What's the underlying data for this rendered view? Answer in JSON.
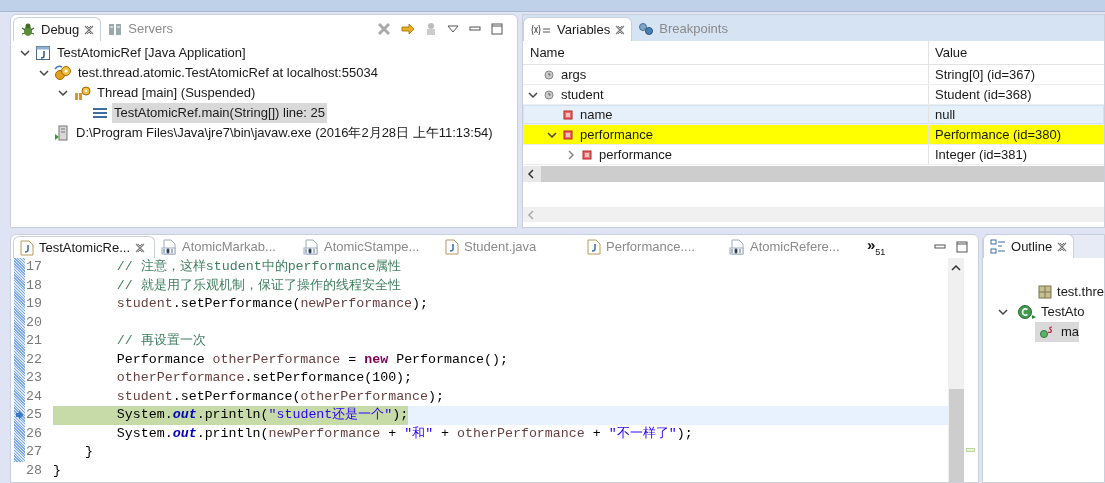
{
  "debug_view": {
    "tabs": [
      {
        "label": "Debug",
        "selected": true,
        "kind": "bug"
      },
      {
        "label": "Servers",
        "selected": false,
        "kind": "servers"
      }
    ],
    "tree": [
      {
        "label": "TestAtomicRef [Java Application]",
        "kind": "launch",
        "expanded": true,
        "selected": false,
        "children": [
          {
            "label": "test.thread.atomic.TestAtomicRef at localhost:55034",
            "kind": "vm",
            "expanded": true,
            "selected": false,
            "children": [
              {
                "label": "Thread [main] (Suspended)",
                "kind": "thread",
                "expanded": true,
                "selected": false,
                "children": [
                  {
                    "label": "TestAtomicRef.main(String[]) line: 25",
                    "kind": "frame",
                    "selected": true
                  }
                ]
              }
            ]
          },
          {
            "label": "D:\\Program Files\\Java\\jre7\\bin\\javaw.exe (2016年2月28日 上午11:13:54)",
            "kind": "process",
            "selected": false
          }
        ]
      }
    ]
  },
  "variables_view": {
    "tabs": [
      {
        "label": "Variables",
        "selected": true,
        "kind": "variables"
      },
      {
        "label": "Breakpoints",
        "selected": false,
        "kind": "breakpoints"
      }
    ],
    "columns": [
      "Name",
      "Value"
    ],
    "rows": [
      {
        "name": "args",
        "value": "String[0]  (id=367)",
        "kind": "local",
        "selected": false,
        "changed": false
      },
      {
        "name": "student",
        "value": "Student  (id=368)",
        "kind": "local",
        "expanded": true,
        "selected": false,
        "changed": false,
        "children": [
          {
            "name": "name",
            "value": "null",
            "kind": "field",
            "selected": true,
            "changed": false
          },
          {
            "name": "performance",
            "value": "Performance  (id=380)",
            "kind": "field",
            "expanded": true,
            "selected": false,
            "changed": true,
            "children": [
              {
                "name": "performance",
                "value": "Integer  (id=381)",
                "kind": "field",
                "expanded": false,
                "selected": false,
                "changed": false
              }
            ]
          }
        ]
      }
    ]
  },
  "editor": {
    "tabs": [
      {
        "label": "TestAtomicRe...",
        "selected": true,
        "kind": "java"
      },
      {
        "label": "AtomicMarkab...",
        "selected": false,
        "kind": "class"
      },
      {
        "label": "AtomicStampe...",
        "selected": false,
        "kind": "class"
      },
      {
        "label": "Student.java",
        "selected": false,
        "kind": "java"
      },
      {
        "label": "Performance....",
        "selected": false,
        "kind": "java"
      },
      {
        "label": "AtomicRefere...",
        "selected": false,
        "kind": "class"
      }
    ],
    "overflow": {
      "symbol": "»",
      "count": "51"
    },
    "lines": [
      {
        "number": "17",
        "current": false,
        "tokens": [
          {
            "kind": "comment",
            "text": "        // 注意，这样student中的performance属性"
          }
        ]
      },
      {
        "number": "18",
        "current": false,
        "tokens": [
          {
            "kind": "comment",
            "text": "        // 就是用了乐观机制，保证了操作的线程安全性"
          }
        ]
      },
      {
        "number": "19",
        "current": false,
        "tokens": [
          {
            "kind": "var",
            "text": "        student"
          },
          {
            "kind": "plain",
            "text": ".setPerformance("
          },
          {
            "kind": "var",
            "text": "newPerformance"
          },
          {
            "kind": "plain",
            "text": ");"
          }
        ]
      },
      {
        "number": "20",
        "current": false
      },
      {
        "number": "21",
        "current": false,
        "tokens": [
          {
            "kind": "comment",
            "text": "        // 再设置一次"
          }
        ]
      },
      {
        "number": "22",
        "current": false,
        "tokens": [
          {
            "kind": "plain",
            "text": "        Performance "
          },
          {
            "kind": "var",
            "text": "otherPerformance"
          },
          {
            "kind": "plain",
            "text": " = "
          },
          {
            "kind": "keyword",
            "text": "new"
          },
          {
            "kind": "plain",
            "text": " Performance();"
          }
        ]
      },
      {
        "number": "23",
        "current": false,
        "tokens": [
          {
            "kind": "var",
            "text": "        otherPerformance"
          },
          {
            "kind": "plain",
            "text": ".setPerformance(100);"
          }
        ]
      },
      {
        "number": "24",
        "current": false,
        "tokens": [
          {
            "kind": "var",
            "text": "        student"
          },
          {
            "kind": "plain",
            "text": ".setPerformance("
          },
          {
            "kind": "var",
            "text": "otherPerformance"
          },
          {
            "kind": "plain",
            "text": ");"
          }
        ]
      },
      {
        "number": "25",
        "current": true,
        "tokens": [
          {
            "kind": "plain",
            "text": "        System."
          },
          {
            "kind": "static",
            "text": "out"
          },
          {
            "kind": "plain",
            "text": ".println("
          },
          {
            "kind": "string",
            "text": "\"student还是一个\""
          },
          {
            "kind": "plain",
            "text": ");"
          }
        ]
      },
      {
        "number": "26",
        "current": false,
        "tokens": [
          {
            "kind": "plain",
            "text": "        System."
          },
          {
            "kind": "static",
            "text": "out"
          },
          {
            "kind": "plain",
            "text": ".println("
          },
          {
            "kind": "var",
            "text": "newPerformance"
          },
          {
            "kind": "plain",
            "text": " + "
          },
          {
            "kind": "string",
            "text": "\"和\""
          },
          {
            "kind": "plain",
            "text": " + "
          },
          {
            "kind": "var",
            "text": "otherPerformance"
          },
          {
            "kind": "plain",
            "text": " + "
          },
          {
            "kind": "string",
            "text": "\"不一样了\""
          },
          {
            "kind": "plain",
            "text": ");"
          }
        ]
      },
      {
        "number": "27",
        "current": false,
        "tokens": [
          {
            "kind": "plain",
            "text": "    }"
          }
        ]
      },
      {
        "number": "28",
        "current": false,
        "tokens": [
          {
            "kind": "plain",
            "text": "}"
          }
        ]
      }
    ]
  },
  "outline_view": {
    "tabs": [
      {
        "label": "Outline",
        "selected": true
      }
    ],
    "tree": [
      {
        "label": "test.thre",
        "kind": "package",
        "selected": false
      },
      {
        "label": "TestAto",
        "kind": "class",
        "expanded": true,
        "selected": false,
        "children": [
          {
            "label": "ma",
            "kind": "method",
            "selected": true
          }
        ]
      }
    ]
  }
}
